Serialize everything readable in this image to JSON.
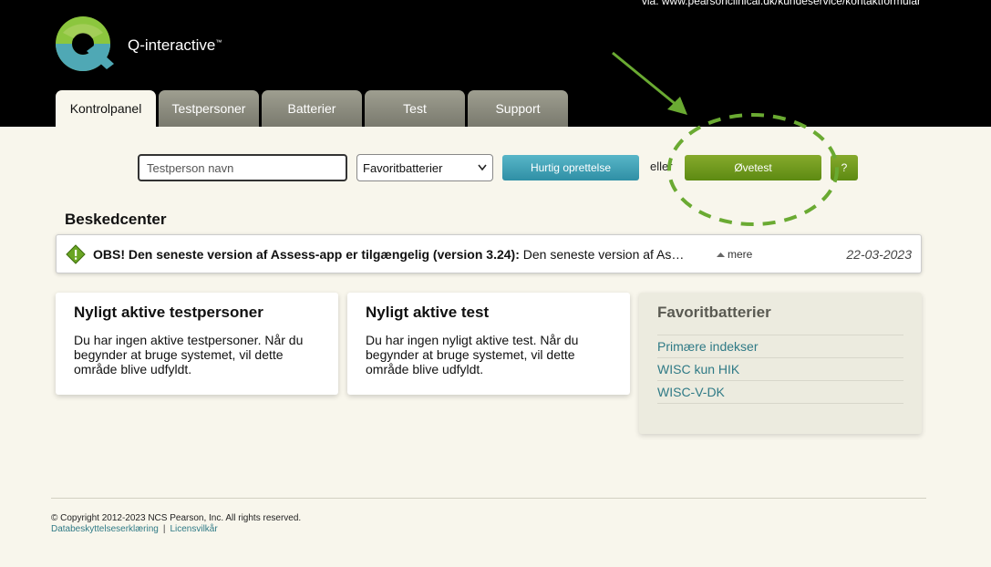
{
  "header": {
    "top_note": "via: www.pearsonclinical.dk/kundeservice/kontaktformular",
    "brand": "Q-interactive",
    "brand_tm": "™"
  },
  "tabs": [
    {
      "label": "Kontrolpanel",
      "active": true
    },
    {
      "label": "Testpersoner",
      "active": false
    },
    {
      "label": "Batterier",
      "active": false
    },
    {
      "label": "Test",
      "active": false
    },
    {
      "label": "Support",
      "active": false
    }
  ],
  "toolbar": {
    "search_placeholder": "Testperson navn",
    "select_value": "Favoritbatterier",
    "quick_create": "Hurtig oprettelse",
    "or": "eller",
    "practice_test": "Øvetest",
    "help": "?"
  },
  "message_center": {
    "title": "Beskedcenter",
    "message_bold": "OBS! Den seneste version af Assess-app er tilgængelig (version 3.24):",
    "message_text": " Den seneste version af Ass...",
    "more": "mere",
    "date": "22-03-2023"
  },
  "recent_persons": {
    "title": "Nyligt aktive testpersoner",
    "text": "Du har ingen aktive testpersoner. Når du begynder at bruge systemet, vil dette område blive udfyldt."
  },
  "recent_tests": {
    "title": "Nyligt aktive test",
    "text": "Du har ingen nyligt aktive test. Når du begynder at bruge systemet, vil dette område blive udfyldt."
  },
  "favorites": {
    "title": "Favoritbatterier",
    "items": [
      "Primære indekser",
      "WISC kun HIK",
      "WISC-V-DK"
    ]
  },
  "footer": {
    "copyright": "© Copyright 2012-2023 NCS Pearson, Inc. All rights reserved.",
    "privacy": "Databeskyttelseserklæring",
    "separator": "|",
    "license": "Licensvilkår"
  },
  "colors": {
    "header_bg": "#000000",
    "page_bg": "#f8f6ec",
    "accent_teal": "#2f8fa5",
    "accent_green": "#5d8a12",
    "annotation_green": "#6aaa32",
    "link_color": "#2f7a86"
  },
  "icons": {
    "logo": "q-interactive-logo",
    "message": "warning-diamond-icon",
    "more": "triangle-up-icon"
  }
}
